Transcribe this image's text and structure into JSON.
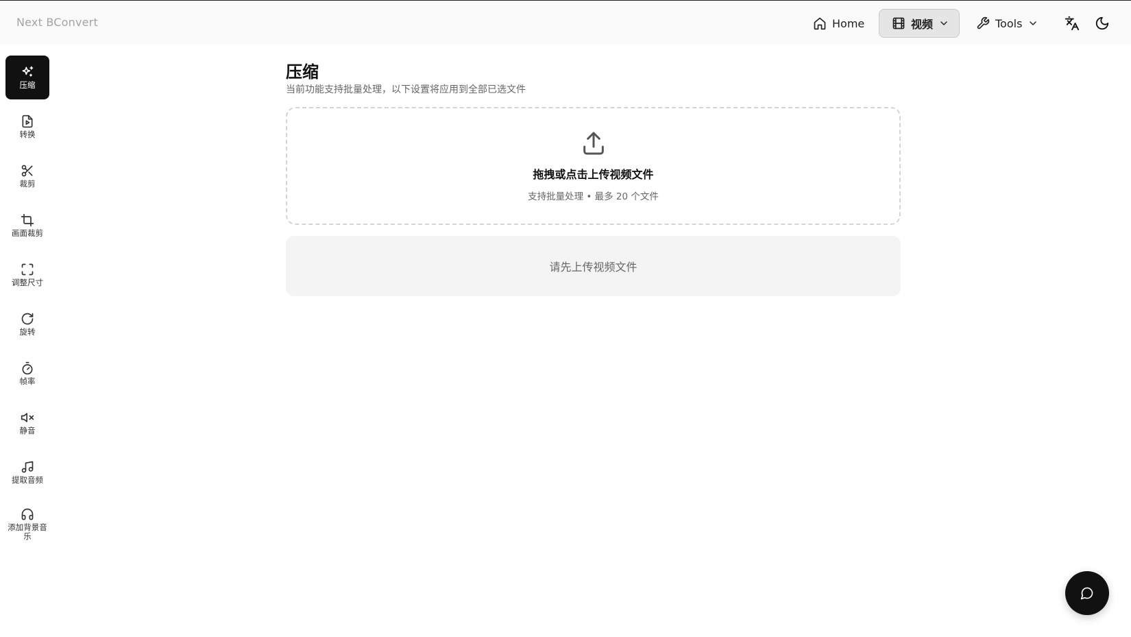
{
  "header": {
    "brand": "Next BConvert",
    "nav": {
      "home": "Home",
      "video": "视频",
      "tools": "Tools"
    }
  },
  "sidebar": {
    "items": [
      {
        "label": "压缩",
        "icon": "sparkles-icon",
        "active": true
      },
      {
        "label": "转换",
        "icon": "file-video-icon",
        "active": false
      },
      {
        "label": "裁剪",
        "icon": "scissors-icon",
        "active": false
      },
      {
        "label": "画面裁剪",
        "icon": "crop-icon",
        "active": false
      },
      {
        "label": "调整尺寸",
        "icon": "expand-icon",
        "active": false
      },
      {
        "label": "旋转",
        "icon": "rotate-icon",
        "active": false
      },
      {
        "label": "帧率",
        "icon": "timer-icon",
        "active": false
      },
      {
        "label": "静音",
        "icon": "volume-mute-icon",
        "active": false
      },
      {
        "label": "提取音频",
        "icon": "music-icon",
        "active": false
      },
      {
        "label": "添加背景音乐",
        "icon": "headphones-icon",
        "active": false
      }
    ]
  },
  "main": {
    "title": "压缩",
    "subtitle": "当前功能支持批量处理，以下设置将应用到全部已选文件",
    "dropzone": {
      "title": "拖拽或点击上传视频文件",
      "hint": "支持批量处理 • 最多 20 个文件"
    },
    "placeholder": "请先上传视频文件"
  },
  "colors": {
    "active_bg": "#111111",
    "panel_bg": "#f4f4f4",
    "topbar_bg": "#fafafa"
  }
}
